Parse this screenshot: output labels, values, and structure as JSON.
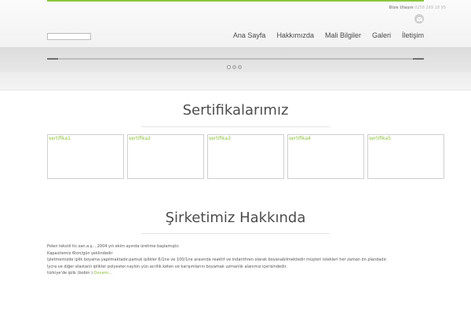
{
  "header": {
    "contact_label": "Bize Ulaşın",
    "phone": "0258 269 18 95",
    "search_placeholder": "",
    "mail_icon": "mail-icon"
  },
  "nav": {
    "items": [
      {
        "label": "Ana Sayfa"
      },
      {
        "label": "Hakkımızda"
      },
      {
        "label": "Mali Bilgiler"
      },
      {
        "label": "Galeri"
      },
      {
        "label": "İletişim"
      }
    ]
  },
  "slider": {
    "slide_count": 3,
    "active_index": 0
  },
  "certificates": {
    "title": "Sertifikalarımız",
    "items": [
      {
        "label": "sertifika1"
      },
      {
        "label": "sertifika2"
      },
      {
        "label": "sertifika3"
      },
      {
        "label": "sertifika4"
      },
      {
        "label": "sertifika5"
      }
    ]
  },
  "about": {
    "title": "Şirketimiz Hakkında",
    "lines": [
      "Polen tekstil tic.san.a.ş....2004 yılı ekim ayında üretime başlamıştır.",
      "Kapasitemiz 6ton/gün şeklindedir",
      "işletmemizde iplik boyama yapılmaktadır.pamuk iplikler 6/1ne ve 100/1ne arasında reaktif ve indanthren olarak boyanabilmektedir müşteri istekleri her zaman ön plandadır.",
      "lycra ve diğer elastanlı iplikler polyester.naylon.yün.acrilik.keten ve karışımlarını boyamak uzmanlık alanımız içerisindedir.",
      "türkiye'de iplik (bobin )"
    ],
    "read_more": "Devamı..."
  },
  "colors": {
    "accent": "#8cc63f",
    "link": "#8bbf3c",
    "text": "#4d4d4d"
  }
}
